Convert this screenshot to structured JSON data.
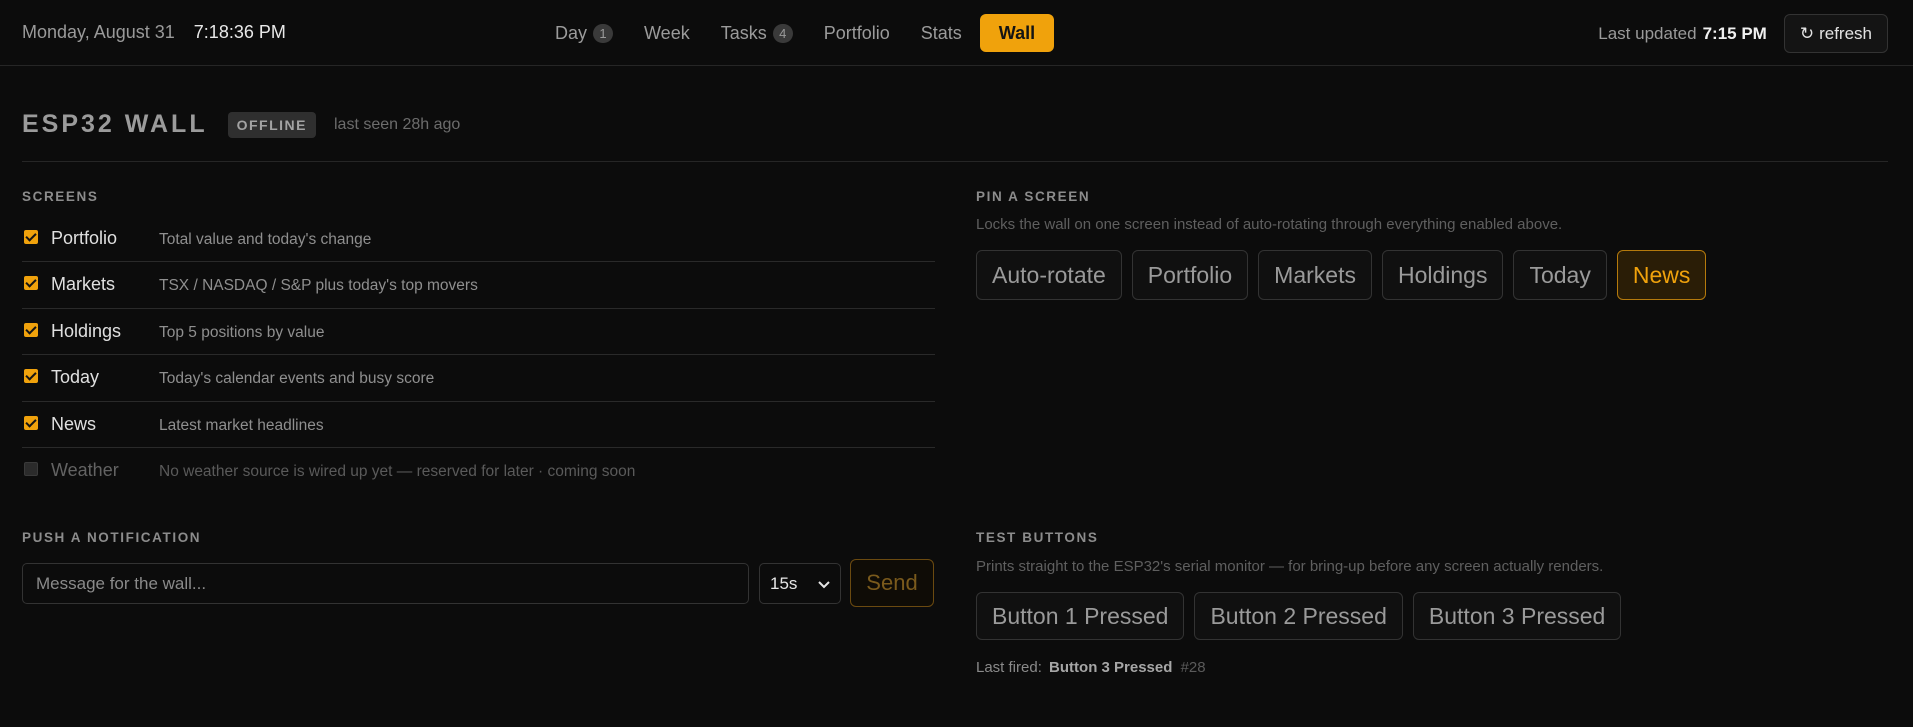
{
  "topbar": {
    "date": "Monday, August 31",
    "time": "7:18:36 PM",
    "nav": [
      {
        "label": "Day",
        "badge": "1"
      },
      {
        "label": "Week"
      },
      {
        "label": "Tasks",
        "badge": "4"
      },
      {
        "label": "Portfolio"
      },
      {
        "label": "Stats"
      },
      {
        "label": "Wall",
        "active": true
      }
    ],
    "last_updated_label": "Last updated",
    "last_updated_time": "7:15 PM",
    "refresh_icon": "↻",
    "refresh_label": "refresh"
  },
  "header": {
    "title": "ESP32 WALL",
    "status": "OFFLINE",
    "last_seen": "last seen 28h ago"
  },
  "screens": {
    "label": "SCREENS",
    "items": [
      {
        "name": "Portfolio",
        "desc": "Total value and today's change",
        "checked": true
      },
      {
        "name": "Markets",
        "desc": "TSX / NASDAQ / S&P plus today's top movers",
        "checked": true
      },
      {
        "name": "Holdings",
        "desc": "Top 5 positions by value",
        "checked": true
      },
      {
        "name": "Today",
        "desc": "Today's calendar events and busy score",
        "checked": true
      },
      {
        "name": "News",
        "desc": "Latest market headlines",
        "checked": true
      },
      {
        "name": "Weather",
        "desc": "No weather source is wired up yet — reserved for later · coming soon",
        "checked": false
      }
    ]
  },
  "pin": {
    "label": "PIN A SCREEN",
    "desc": "Locks the wall on one screen instead of auto-rotating through everything enabled above.",
    "options": [
      "Auto-rotate",
      "Portfolio",
      "Markets",
      "Holdings",
      "Today",
      "News"
    ],
    "selected": "News"
  },
  "notify": {
    "label": "PUSH A NOTIFICATION",
    "placeholder": "Message for the wall...",
    "duration": "15s",
    "send_label": "Send"
  },
  "test": {
    "label": "TEST BUTTONS",
    "desc": "Prints straight to the ESP32's serial monitor — for bring-up before any screen actually renders.",
    "buttons": [
      "Button 1 Pressed",
      "Button 2 Pressed",
      "Button 3 Pressed"
    ],
    "last_fired_label": "Last fired:",
    "last_fired_name": "Button 3 Pressed",
    "last_fired_count": "#28"
  },
  "colors": {
    "accent": "#f0a20c",
    "background": "#0c0c0c"
  }
}
